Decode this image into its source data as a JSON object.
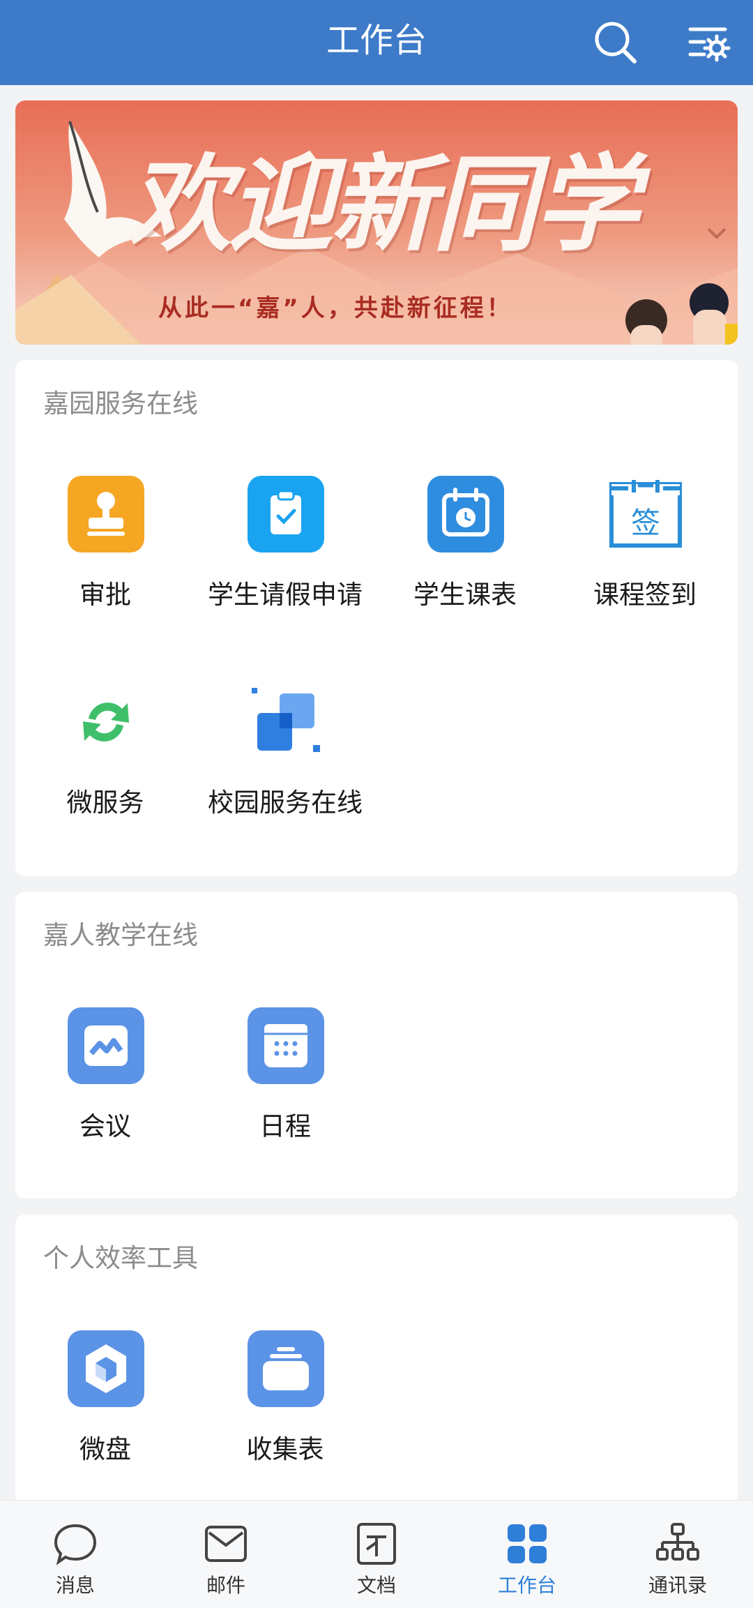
{
  "header": {
    "title": "工作台",
    "search_icon": "search-icon",
    "settings_icon": "list-settings-icon",
    "bg_color": "#3d7bc9"
  },
  "banner": {
    "headline": "欢迎新同学",
    "subline": "从此一“嘉”人，共赴新征程！",
    "collapse_icon": "chevron-down-icon"
  },
  "sections": [
    {
      "title": "嘉园服务在线",
      "items": [
        {
          "label": "审批",
          "icon": "stamp-icon",
          "color": "#f5a623"
        },
        {
          "label": "学生请假申请",
          "icon": "clipboard-check-icon",
          "color": "#1aa3f0"
        },
        {
          "label": "学生课表",
          "icon": "calendar-clock-icon",
          "color": "#2f8de0"
        },
        {
          "label": "课程签到",
          "icon": "sign-calendar-icon",
          "color": "#2a8ed8"
        },
        {
          "label": "微服务",
          "icon": "green-arrows-icon",
          "color": "#3fbf6a"
        },
        {
          "label": "校园服务在线",
          "icon": "blue-squares-icon",
          "color": "#2f7fe0"
        }
      ]
    },
    {
      "title": "嘉人教学在线",
      "items": [
        {
          "label": "会议",
          "icon": "meeting-icon",
          "color": "#5b93e6"
        },
        {
          "label": "日程",
          "icon": "schedule-icon",
          "color": "#5b93e6"
        }
      ]
    },
    {
      "title": "个人效率工具",
      "items": [
        {
          "label": "微盘",
          "icon": "cube-drive-icon",
          "color": "#5b93e6"
        },
        {
          "label": "收集表",
          "icon": "collect-form-icon",
          "color": "#5b93e6"
        }
      ]
    }
  ],
  "tabs": [
    {
      "label": "消息",
      "icon": "chat-bubble-icon",
      "active": false
    },
    {
      "label": "邮件",
      "icon": "mail-icon",
      "active": false
    },
    {
      "label": "文档",
      "icon": "document-icon",
      "active": false
    },
    {
      "label": "工作台",
      "icon": "grid-icon",
      "active": true
    },
    {
      "label": "通讯录",
      "icon": "org-chart-icon",
      "active": false
    }
  ],
  "active_tab_color": "#2f7fd8"
}
